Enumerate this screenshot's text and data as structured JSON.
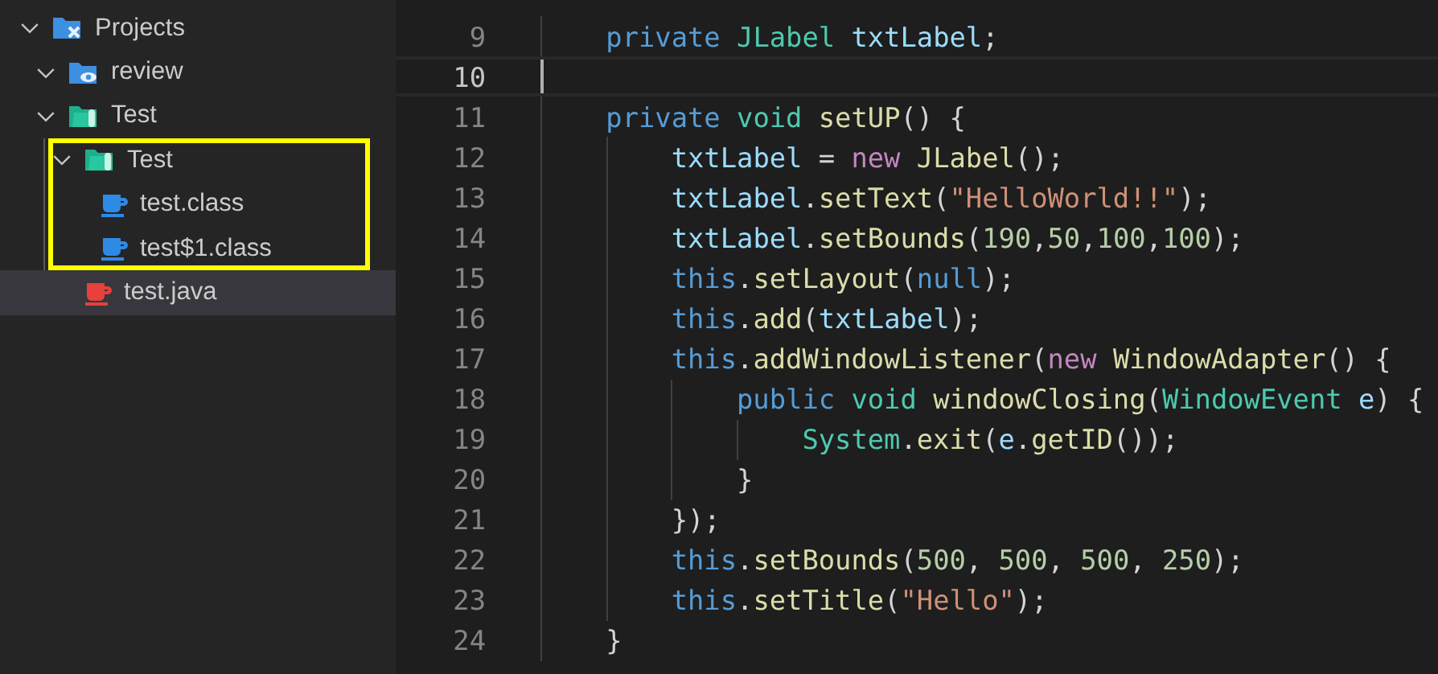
{
  "explorer": {
    "tree": [
      {
        "label": "Projects",
        "kind": "folder-tools",
        "expanded": true,
        "selected": false,
        "highlighted": false,
        "children": [
          {
            "label": "review",
            "kind": "folder-eye",
            "expanded": true,
            "selected": false,
            "highlighted": false
          },
          {
            "label": "Test",
            "kind": "folder-test",
            "expanded": true,
            "selected": false,
            "highlighted": false,
            "children": [
              {
                "label": "Test",
                "kind": "folder-test",
                "expanded": true,
                "selected": false,
                "highlighted": true,
                "children": [
                  {
                    "label": "test.class",
                    "kind": "class-file",
                    "selected": false,
                    "highlighted": false
                  },
                  {
                    "label": "test$1.class",
                    "kind": "class-file",
                    "selected": false,
                    "highlighted": false
                  }
                ]
              },
              {
                "label": "test.java",
                "kind": "java-file",
                "selected": true,
                "highlighted": false
              }
            ]
          }
        ]
      }
    ]
  },
  "editor": {
    "lines": [
      {
        "number": "9",
        "current": false,
        "tokens": [
          {
            "text": "private ",
            "kind": "keyword"
          },
          {
            "text": "JLabel ",
            "kind": "type"
          },
          {
            "text": "txtLabel",
            "kind": "variable"
          },
          {
            "text": ";",
            "kind": "plain"
          }
        ]
      },
      {
        "number": "10",
        "current": true
      },
      {
        "number": "11",
        "current": false,
        "tokens": [
          {
            "text": "private ",
            "kind": "keyword"
          },
          {
            "text": "void ",
            "kind": "type"
          },
          {
            "text": "setUP",
            "kind": "function"
          },
          {
            "text": "() {",
            "kind": "plain"
          }
        ],
        "children": [
          {
            "number": "12",
            "current": false,
            "tokens": [
              {
                "text": "txtLabel",
                "kind": "variable"
              },
              {
                "text": " = ",
                "kind": "plain"
              },
              {
                "text": "new ",
                "kind": "control"
              },
              {
                "text": "JLabel",
                "kind": "function"
              },
              {
                "text": "();",
                "kind": "plain"
              }
            ]
          },
          {
            "number": "13",
            "current": false,
            "tokens": [
              {
                "text": "txtLabel",
                "kind": "variable"
              },
              {
                "text": ".",
                "kind": "plain"
              },
              {
                "text": "setText",
                "kind": "function"
              },
              {
                "text": "(",
                "kind": "plain"
              },
              {
                "text": "\"HelloWorld!!\"",
                "kind": "string"
              },
              {
                "text": ");",
                "kind": "plain"
              }
            ]
          },
          {
            "number": "14",
            "current": false,
            "tokens": [
              {
                "text": "txtLabel",
                "kind": "variable"
              },
              {
                "text": ".",
                "kind": "plain"
              },
              {
                "text": "setBounds",
                "kind": "function"
              },
              {
                "text": "(",
                "kind": "plain"
              },
              {
                "text": "190",
                "kind": "number"
              },
              {
                "text": ",",
                "kind": "plain"
              },
              {
                "text": "50",
                "kind": "number"
              },
              {
                "text": ",",
                "kind": "plain"
              },
              {
                "text": "100",
                "kind": "number"
              },
              {
                "text": ",",
                "kind": "plain"
              },
              {
                "text": "100",
                "kind": "number"
              },
              {
                "text": ");",
                "kind": "plain"
              }
            ]
          },
          {
            "number": "15",
            "current": false,
            "tokens": [
              {
                "text": "this",
                "kind": "keyword"
              },
              {
                "text": ".",
                "kind": "plain"
              },
              {
                "text": "setLayout",
                "kind": "function"
              },
              {
                "text": "(",
                "kind": "plain"
              },
              {
                "text": "null",
                "kind": "keyword"
              },
              {
                "text": ");",
                "kind": "plain"
              }
            ]
          },
          {
            "number": "16",
            "current": false,
            "tokens": [
              {
                "text": "this",
                "kind": "keyword"
              },
              {
                "text": ".",
                "kind": "plain"
              },
              {
                "text": "add",
                "kind": "function"
              },
              {
                "text": "(",
                "kind": "plain"
              },
              {
                "text": "txtLabel",
                "kind": "variable"
              },
              {
                "text": ");",
                "kind": "plain"
              }
            ]
          },
          {
            "number": "17",
            "current": false,
            "tokens": [
              {
                "text": "this",
                "kind": "keyword"
              },
              {
                "text": ".",
                "kind": "plain"
              },
              {
                "text": "addWindowListener",
                "kind": "function"
              },
              {
                "text": "(",
                "kind": "plain"
              },
              {
                "text": "new ",
                "kind": "control"
              },
              {
                "text": "WindowAdapter",
                "kind": "function"
              },
              {
                "text": "() {",
                "kind": "plain"
              }
            ],
            "children": [
              {
                "number": "18",
                "current": false,
                "tokens": [
                  {
                    "text": "public ",
                    "kind": "keyword"
                  },
                  {
                    "text": "void ",
                    "kind": "type"
                  },
                  {
                    "text": "windowClosing",
                    "kind": "function"
                  },
                  {
                    "text": "(",
                    "kind": "plain"
                  },
                  {
                    "text": "WindowEvent ",
                    "kind": "type"
                  },
                  {
                    "text": "e",
                    "kind": "variable"
                  },
                  {
                    "text": ") {",
                    "kind": "plain"
                  }
                ],
                "children": [
                  {
                    "number": "19",
                    "current": false,
                    "tokens": [
                      {
                        "text": "System",
                        "kind": "type"
                      },
                      {
                        "text": ".",
                        "kind": "plain"
                      },
                      {
                        "text": "exit",
                        "kind": "function"
                      },
                      {
                        "text": "(",
                        "kind": "plain"
                      },
                      {
                        "text": "e",
                        "kind": "variable"
                      },
                      {
                        "text": ".",
                        "kind": "plain"
                      },
                      {
                        "text": "getID",
                        "kind": "function"
                      },
                      {
                        "text": "());",
                        "kind": "plain"
                      }
                    ]
                  }
                ]
              },
              {
                "number": "20",
                "current": false,
                "tokens": [
                  {
                    "text": "}",
                    "kind": "plain"
                  }
                ]
              }
            ]
          },
          {
            "number": "21",
            "current": false,
            "tokens": [
              {
                "text": "});",
                "kind": "plain"
              }
            ]
          },
          {
            "number": "22",
            "current": false,
            "tokens": [
              {
                "text": "this",
                "kind": "keyword"
              },
              {
                "text": ".",
                "kind": "plain"
              },
              {
                "text": "setBounds",
                "kind": "function"
              },
              {
                "text": "(",
                "kind": "plain"
              },
              {
                "text": "500",
                "kind": "number"
              },
              {
                "text": ", ",
                "kind": "plain"
              },
              {
                "text": "500",
                "kind": "number"
              },
              {
                "text": ", ",
                "kind": "plain"
              },
              {
                "text": "500",
                "kind": "number"
              },
              {
                "text": ", ",
                "kind": "plain"
              },
              {
                "text": "250",
                "kind": "number"
              },
              {
                "text": ");",
                "kind": "plain"
              }
            ]
          },
          {
            "number": "23",
            "current": false,
            "tokens": [
              {
                "text": "this",
                "kind": "keyword"
              },
              {
                "text": ".",
                "kind": "plain"
              },
              {
                "text": "setTitle",
                "kind": "function"
              },
              {
                "text": "(",
                "kind": "plain"
              },
              {
                "text": "\"Hello\"",
                "kind": "string"
              },
              {
                "text": ");",
                "kind": "plain"
              }
            ]
          }
        ]
      },
      {
        "number": "24",
        "current": false,
        "tokens": [
          {
            "text": "}",
            "kind": "plain"
          }
        ]
      }
    ]
  }
}
